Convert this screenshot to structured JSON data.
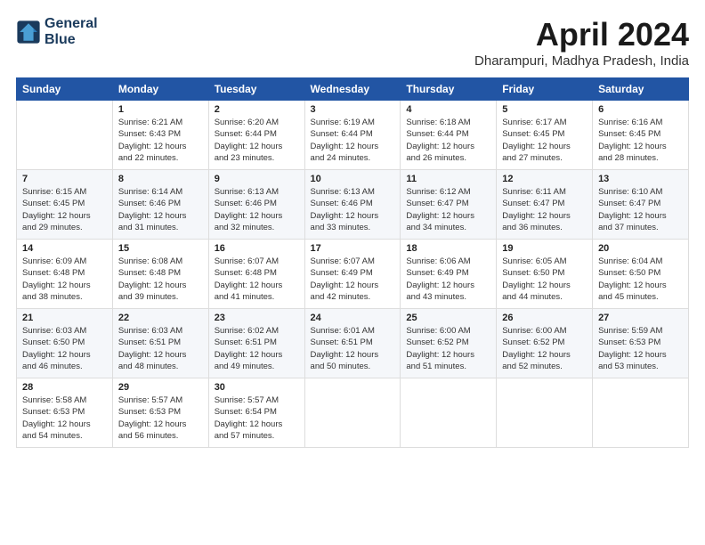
{
  "header": {
    "logo_line1": "General",
    "logo_line2": "Blue",
    "month": "April 2024",
    "location": "Dharampuri, Madhya Pradesh, India"
  },
  "days_of_week": [
    "Sunday",
    "Monday",
    "Tuesday",
    "Wednesday",
    "Thursday",
    "Friday",
    "Saturday"
  ],
  "weeks": [
    [
      {
        "num": "",
        "sunrise": "",
        "sunset": "",
        "daylight": ""
      },
      {
        "num": "1",
        "sunrise": "Sunrise: 6:21 AM",
        "sunset": "Sunset: 6:43 PM",
        "daylight": "Daylight: 12 hours and 22 minutes."
      },
      {
        "num": "2",
        "sunrise": "Sunrise: 6:20 AM",
        "sunset": "Sunset: 6:44 PM",
        "daylight": "Daylight: 12 hours and 23 minutes."
      },
      {
        "num": "3",
        "sunrise": "Sunrise: 6:19 AM",
        "sunset": "Sunset: 6:44 PM",
        "daylight": "Daylight: 12 hours and 24 minutes."
      },
      {
        "num": "4",
        "sunrise": "Sunrise: 6:18 AM",
        "sunset": "Sunset: 6:44 PM",
        "daylight": "Daylight: 12 hours and 26 minutes."
      },
      {
        "num": "5",
        "sunrise": "Sunrise: 6:17 AM",
        "sunset": "Sunset: 6:45 PM",
        "daylight": "Daylight: 12 hours and 27 minutes."
      },
      {
        "num": "6",
        "sunrise": "Sunrise: 6:16 AM",
        "sunset": "Sunset: 6:45 PM",
        "daylight": "Daylight: 12 hours and 28 minutes."
      }
    ],
    [
      {
        "num": "7",
        "sunrise": "Sunrise: 6:15 AM",
        "sunset": "Sunset: 6:45 PM",
        "daylight": "Daylight: 12 hours and 29 minutes."
      },
      {
        "num": "8",
        "sunrise": "Sunrise: 6:14 AM",
        "sunset": "Sunset: 6:46 PM",
        "daylight": "Daylight: 12 hours and 31 minutes."
      },
      {
        "num": "9",
        "sunrise": "Sunrise: 6:13 AM",
        "sunset": "Sunset: 6:46 PM",
        "daylight": "Daylight: 12 hours and 32 minutes."
      },
      {
        "num": "10",
        "sunrise": "Sunrise: 6:13 AM",
        "sunset": "Sunset: 6:46 PM",
        "daylight": "Daylight: 12 hours and 33 minutes."
      },
      {
        "num": "11",
        "sunrise": "Sunrise: 6:12 AM",
        "sunset": "Sunset: 6:47 PM",
        "daylight": "Daylight: 12 hours and 34 minutes."
      },
      {
        "num": "12",
        "sunrise": "Sunrise: 6:11 AM",
        "sunset": "Sunset: 6:47 PM",
        "daylight": "Daylight: 12 hours and 36 minutes."
      },
      {
        "num": "13",
        "sunrise": "Sunrise: 6:10 AM",
        "sunset": "Sunset: 6:47 PM",
        "daylight": "Daylight: 12 hours and 37 minutes."
      }
    ],
    [
      {
        "num": "14",
        "sunrise": "Sunrise: 6:09 AM",
        "sunset": "Sunset: 6:48 PM",
        "daylight": "Daylight: 12 hours and 38 minutes."
      },
      {
        "num": "15",
        "sunrise": "Sunrise: 6:08 AM",
        "sunset": "Sunset: 6:48 PM",
        "daylight": "Daylight: 12 hours and 39 minutes."
      },
      {
        "num": "16",
        "sunrise": "Sunrise: 6:07 AM",
        "sunset": "Sunset: 6:48 PM",
        "daylight": "Daylight: 12 hours and 41 minutes."
      },
      {
        "num": "17",
        "sunrise": "Sunrise: 6:07 AM",
        "sunset": "Sunset: 6:49 PM",
        "daylight": "Daylight: 12 hours and 42 minutes."
      },
      {
        "num": "18",
        "sunrise": "Sunrise: 6:06 AM",
        "sunset": "Sunset: 6:49 PM",
        "daylight": "Daylight: 12 hours and 43 minutes."
      },
      {
        "num": "19",
        "sunrise": "Sunrise: 6:05 AM",
        "sunset": "Sunset: 6:50 PM",
        "daylight": "Daylight: 12 hours and 44 minutes."
      },
      {
        "num": "20",
        "sunrise": "Sunrise: 6:04 AM",
        "sunset": "Sunset: 6:50 PM",
        "daylight": "Daylight: 12 hours and 45 minutes."
      }
    ],
    [
      {
        "num": "21",
        "sunrise": "Sunrise: 6:03 AM",
        "sunset": "Sunset: 6:50 PM",
        "daylight": "Daylight: 12 hours and 46 minutes."
      },
      {
        "num": "22",
        "sunrise": "Sunrise: 6:03 AM",
        "sunset": "Sunset: 6:51 PM",
        "daylight": "Daylight: 12 hours and 48 minutes."
      },
      {
        "num": "23",
        "sunrise": "Sunrise: 6:02 AM",
        "sunset": "Sunset: 6:51 PM",
        "daylight": "Daylight: 12 hours and 49 minutes."
      },
      {
        "num": "24",
        "sunrise": "Sunrise: 6:01 AM",
        "sunset": "Sunset: 6:51 PM",
        "daylight": "Daylight: 12 hours and 50 minutes."
      },
      {
        "num": "25",
        "sunrise": "Sunrise: 6:00 AM",
        "sunset": "Sunset: 6:52 PM",
        "daylight": "Daylight: 12 hours and 51 minutes."
      },
      {
        "num": "26",
        "sunrise": "Sunrise: 6:00 AM",
        "sunset": "Sunset: 6:52 PM",
        "daylight": "Daylight: 12 hours and 52 minutes."
      },
      {
        "num": "27",
        "sunrise": "Sunrise: 5:59 AM",
        "sunset": "Sunset: 6:53 PM",
        "daylight": "Daylight: 12 hours and 53 minutes."
      }
    ],
    [
      {
        "num": "28",
        "sunrise": "Sunrise: 5:58 AM",
        "sunset": "Sunset: 6:53 PM",
        "daylight": "Daylight: 12 hours and 54 minutes."
      },
      {
        "num": "29",
        "sunrise": "Sunrise: 5:57 AM",
        "sunset": "Sunset: 6:53 PM",
        "daylight": "Daylight: 12 hours and 56 minutes."
      },
      {
        "num": "30",
        "sunrise": "Sunrise: 5:57 AM",
        "sunset": "Sunset: 6:54 PM",
        "daylight": "Daylight: 12 hours and 57 minutes."
      },
      {
        "num": "",
        "sunrise": "",
        "sunset": "",
        "daylight": ""
      },
      {
        "num": "",
        "sunrise": "",
        "sunset": "",
        "daylight": ""
      },
      {
        "num": "",
        "sunrise": "",
        "sunset": "",
        "daylight": ""
      },
      {
        "num": "",
        "sunrise": "",
        "sunset": "",
        "daylight": ""
      }
    ]
  ]
}
